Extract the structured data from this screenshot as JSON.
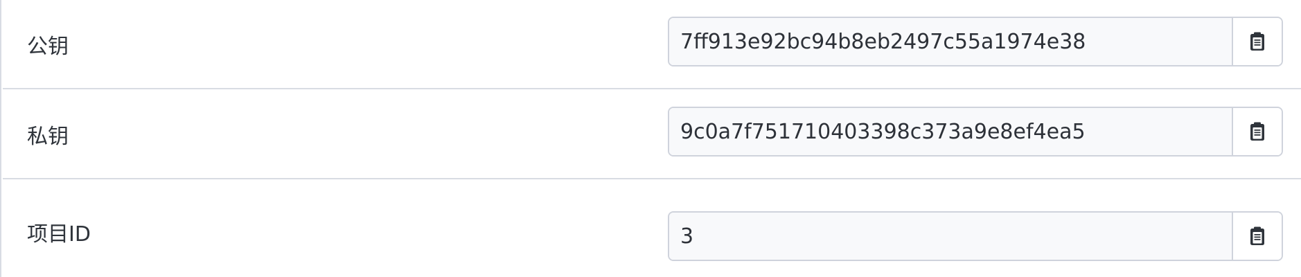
{
  "fields": [
    {
      "label": "公钥",
      "value": "7ff913e92bc94b8eb2497c55a1974e38",
      "copy_icon": "clipboard-icon"
    },
    {
      "label": "私钥",
      "value": "9c0a7f751710403398c373a9e8ef4ea5",
      "copy_icon": "clipboard-icon"
    },
    {
      "label": "项目ID",
      "value": "3",
      "copy_icon": "clipboard-icon"
    }
  ],
  "colors": {
    "border": "#d8dce3",
    "input_background": "#f8f9fb",
    "text": "#2f343b"
  }
}
